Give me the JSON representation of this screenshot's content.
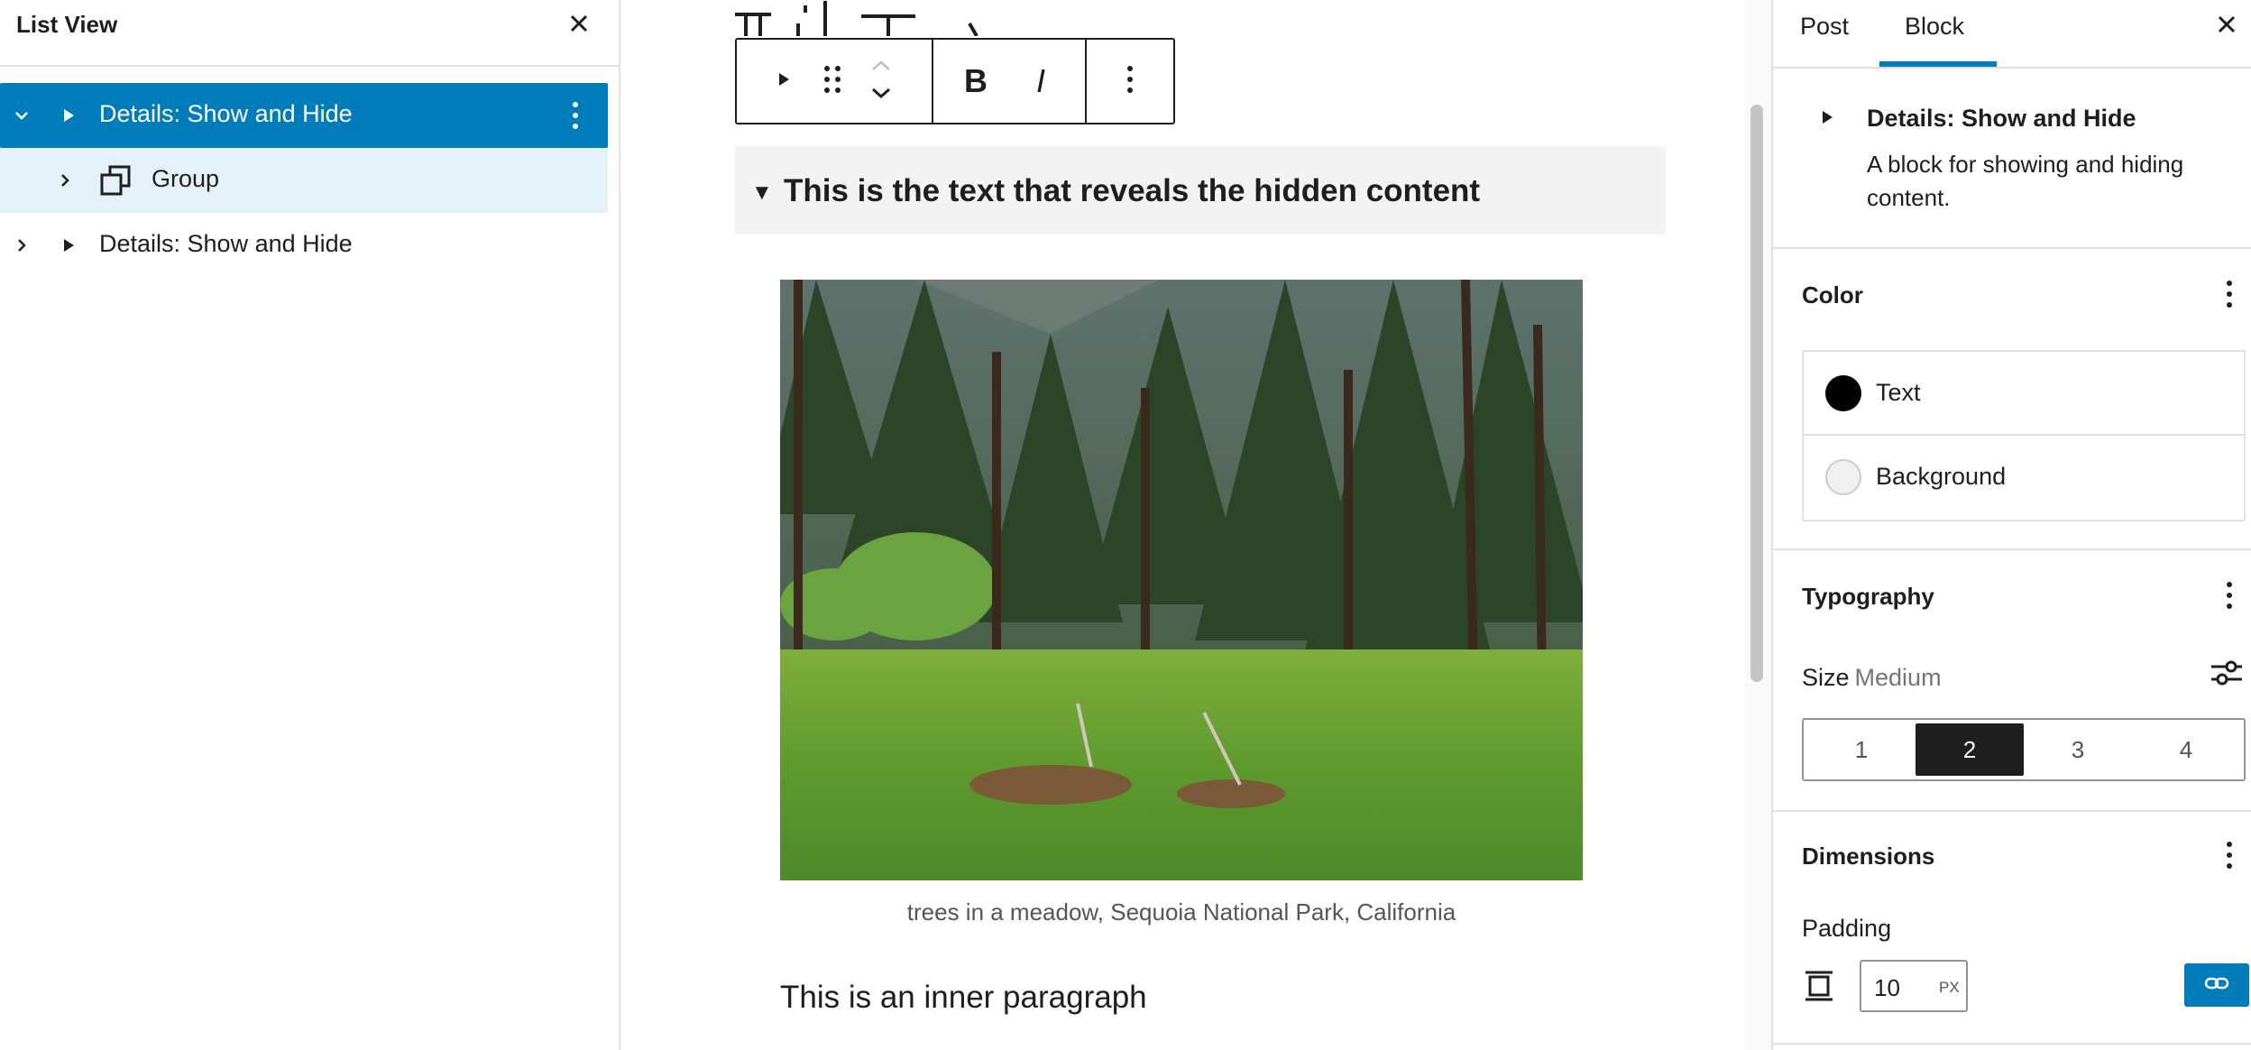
{
  "list_view": {
    "title": "List View",
    "items": [
      {
        "label": "Details: Show and Hide",
        "state": "selected"
      },
      {
        "label": "Group",
        "state": "child-highlight"
      },
      {
        "label": "Details: Show and Hide",
        "state": "normal"
      }
    ]
  },
  "editor": {
    "summary_marker": "▼",
    "summary_text": "This is the text that reveals the hidden content",
    "image_caption": "trees in a meadow, Sequoia National Park, California",
    "inner_paragraph": "This is an inner paragraph",
    "toolbar": {
      "bold_label": "B",
      "italic_label": "I"
    }
  },
  "sidebar": {
    "tabs": [
      {
        "label": "Post",
        "active": false
      },
      {
        "label": "Block",
        "active": true
      }
    ],
    "block_card": {
      "title": "Details: Show and Hide",
      "description": "A block for showing and hiding content."
    },
    "color": {
      "title": "Color",
      "items": [
        {
          "label": "Text",
          "swatch": "#000000"
        },
        {
          "label": "Background",
          "swatch": "#f0f0f0"
        }
      ]
    },
    "typography": {
      "title": "Typography",
      "size_label": "Size",
      "size_value": "Medium",
      "options": [
        "1",
        "2",
        "3",
        "4"
      ],
      "selected": "2"
    },
    "dimensions": {
      "title": "Dimensions",
      "padding_label": "Padding",
      "padding_value": "10",
      "padding_unit": "PX"
    }
  },
  "colors": {
    "accent": "#007cba",
    "selected_row_light": "#e5f1f8",
    "dark": "#1e1e1e"
  }
}
